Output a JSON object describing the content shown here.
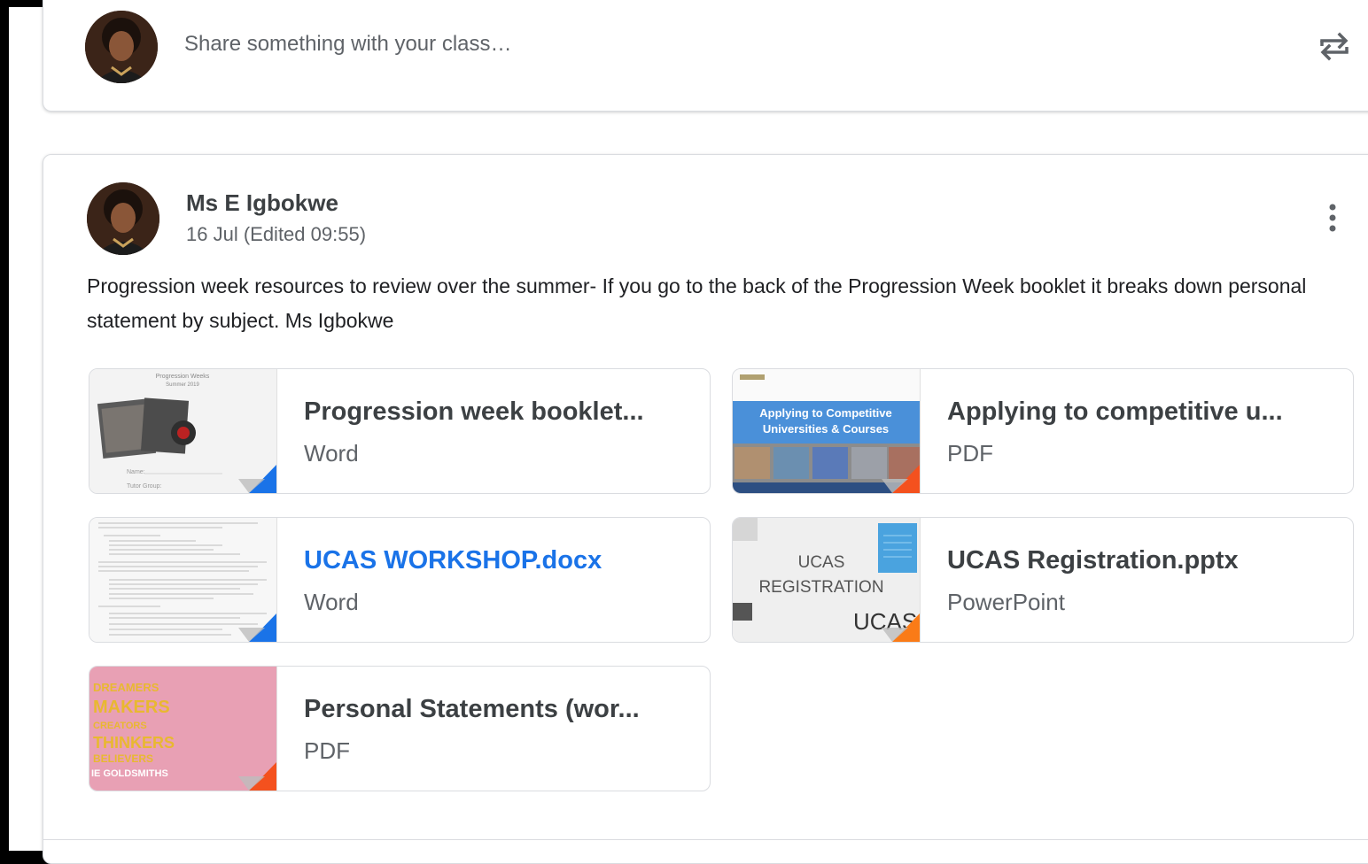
{
  "share": {
    "placeholder": "Share something with your class…"
  },
  "post": {
    "author": "Ms E Igbokwe",
    "date": "16 Jul (Edited 09:55)",
    "body": "Progression week resources to review over the summer- If you go to the back of the Progression Week booklet it breaks down personal statement by subject. Ms Igbokwe",
    "attachments": [
      {
        "title": "Progression week booklet...",
        "type": "Word",
        "accent": "#1a73e8",
        "thumb_text": [
          "Progression Weeks",
          "Summer 2019",
          "Name:",
          "Tutor Group:"
        ]
      },
      {
        "title": "Applying to competitive u...",
        "type": "PDF",
        "accent": "#f4511e",
        "thumb_text": [
          "Applying to Competitive",
          "Universities & Courses"
        ]
      },
      {
        "title": "UCAS WORKSHOP.docx",
        "type": "Word",
        "accent": "#1a73e8"
      },
      {
        "title": "UCAS Registration.pptx",
        "type": "PowerPoint",
        "accent": "#fa7b17",
        "thumb_text": [
          "UCAS",
          "REGISTRATION",
          "UCAS"
        ]
      },
      {
        "title": "Personal Statements (wor...",
        "type": "PDF",
        "accent": "#f4511e",
        "thumb_text": [
          "DREAMERS",
          "MAKERS",
          "CREATORS",
          "THINKERS",
          "BELIEVERS",
          "IE GOLDSMITHS"
        ]
      }
    ]
  },
  "colors": {
    "link": "#1a73e8",
    "text": "#3c4043",
    "secondary": "#5f6368"
  },
  "icons": {
    "repost": "repost-icon",
    "more": "more-vert-icon"
  }
}
